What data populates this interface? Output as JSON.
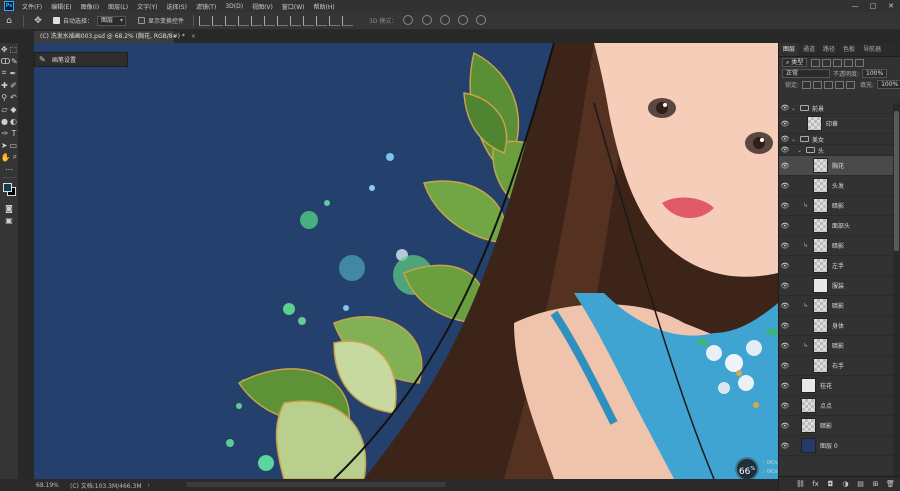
{
  "app": {
    "logo_text": "Ps"
  },
  "menu": [
    "文件(F)",
    "编辑(E)",
    "图像(I)",
    "图层(L)",
    "文字(Y)",
    "选择(S)",
    "滤镜(T)",
    "3D(D)",
    "视图(V)",
    "窗口(W)",
    "帮助(H)"
  ],
  "window_controls": {
    "minimize": "—",
    "maximize": "□",
    "close": "✕"
  },
  "options": {
    "auto_select_label": "自动选择：",
    "auto_select_value": "图层",
    "show_transform_label": "显示变换控件",
    "mode_3d_label": "3D 模式："
  },
  "document_tab": {
    "title": "(C) 洗发水插画003.psd @ 68.2% (胸花, RGB/8#) *",
    "close": "×"
  },
  "brush_flyout": {
    "label": "画笔设置"
  },
  "panel": {
    "tabs": [
      "图层",
      "通道",
      "路径",
      "色板",
      "导航器"
    ],
    "active_tab": "图层",
    "filter_label": "类型",
    "blend_mode": "正常",
    "opacity_label": "不透明度:",
    "opacity_value": "100%",
    "lock_label": "锁定:",
    "fill_label": "填充:",
    "fill_value": "100%"
  },
  "layers": [
    {
      "name": "前景",
      "type": "group",
      "level": 0
    },
    {
      "name": "印章",
      "type": "layer",
      "level": 1
    },
    {
      "name": "美女",
      "type": "group",
      "level": 0
    },
    {
      "name": "头",
      "type": "group",
      "level": 1
    },
    {
      "name": "胸花",
      "type": "layer",
      "level": 2,
      "selected": true
    },
    {
      "name": "头发",
      "type": "layer",
      "level": 2
    },
    {
      "name": "暗影",
      "type": "layer",
      "level": 2,
      "clipped": true
    },
    {
      "name": "面部头",
      "type": "layer",
      "level": 2
    },
    {
      "name": "暗影",
      "type": "layer",
      "level": 2,
      "clipped": true
    },
    {
      "name": "左手",
      "type": "layer",
      "level": 2
    },
    {
      "name": "服装",
      "type": "layer",
      "level": 2,
      "art": true
    },
    {
      "name": "暗影",
      "type": "layer",
      "level": 2,
      "clipped": true
    },
    {
      "name": "身体",
      "type": "layer",
      "level": 2
    },
    {
      "name": "暗影",
      "type": "layer",
      "level": 2,
      "clipped": true
    },
    {
      "name": "右手",
      "type": "layer",
      "level": 2
    },
    {
      "name": "桂花",
      "type": "layer",
      "level": 0,
      "art": true
    },
    {
      "name": "点点",
      "type": "layer",
      "level": 0
    },
    {
      "name": "暗影",
      "type": "layer",
      "level": 0
    },
    {
      "name": "图层 0",
      "type": "layer",
      "level": 0,
      "solid": true
    }
  ],
  "status": {
    "zoom": "68.19%",
    "doc": "(C) 文档:103.3M/466.3M",
    "arrow": "›"
  },
  "perf": {
    "value": "66",
    "unit": "%",
    "up": "0K/s",
    "down": "0K/s"
  },
  "colors": {
    "foreground": "#133c55",
    "background": "#000000",
    "canvas_bg": "#24406d"
  }
}
